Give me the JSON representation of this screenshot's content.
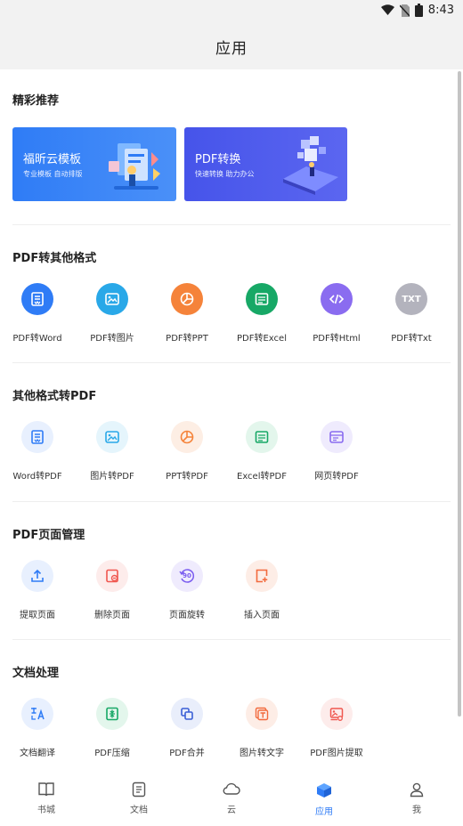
{
  "status": {
    "time": "8:43"
  },
  "header": {
    "title": "应用"
  },
  "recommend": {
    "title": "精彩推荐",
    "banners": [
      {
        "title": "福昕云模板",
        "subtitle": "专业模板  自动排版"
      },
      {
        "title": "PDF转换",
        "subtitle": "快速转换  助力办公"
      }
    ]
  },
  "pdf_to_other": {
    "title": "PDF转其他格式",
    "items": [
      {
        "label": "PDF转Word",
        "color": "#2f7cf6"
      },
      {
        "label": "PDF转图片",
        "color": "#29a8e8"
      },
      {
        "label": "PDF转PPT",
        "color": "#f5833a"
      },
      {
        "label": "PDF转Excel",
        "color": "#17a866"
      },
      {
        "label": "PDF转Html",
        "color": "#8a6cf0"
      },
      {
        "label": "PDF转Txt",
        "color": "#b3b3bd",
        "glyph": "TXT"
      }
    ]
  },
  "other_to_pdf": {
    "title": "其他格式转PDF",
    "items": [
      {
        "label": "Word转PDF",
        "color": "#2f7cf6"
      },
      {
        "label": "图片转PDF",
        "color": "#29a8e8"
      },
      {
        "label": "PPT转PDF",
        "color": "#f5833a"
      },
      {
        "label": "Excel转PDF",
        "color": "#17a866"
      },
      {
        "label": "网页转PDF",
        "color": "#8a6cf0"
      }
    ]
  },
  "page_manage": {
    "title": "PDF页面管理",
    "items": [
      {
        "label": "提取页面",
        "color": "#2f7cf6"
      },
      {
        "label": "删除页面",
        "color": "#f0574f"
      },
      {
        "label": "页面旋转",
        "color": "#7a5cf0",
        "glyph": "90"
      },
      {
        "label": "插入页面",
        "color": "#f26a3d"
      }
    ]
  },
  "doc_process": {
    "title": "文档处理",
    "items": [
      {
        "label": "文档翻译",
        "color": "#2f7cf6"
      },
      {
        "label": "PDF压缩",
        "color": "#17a866"
      },
      {
        "label": "PDF合并",
        "color": "#3a5fd6"
      },
      {
        "label": "图片转文字",
        "color": "#f26a3d"
      },
      {
        "label": "PDF图片提取",
        "color": "#f0574f"
      }
    ]
  },
  "tabbar": {
    "items": [
      {
        "label": "书城"
      },
      {
        "label": "文档"
      },
      {
        "label": "云"
      },
      {
        "label": "应用",
        "active": true
      },
      {
        "label": "我"
      }
    ]
  }
}
